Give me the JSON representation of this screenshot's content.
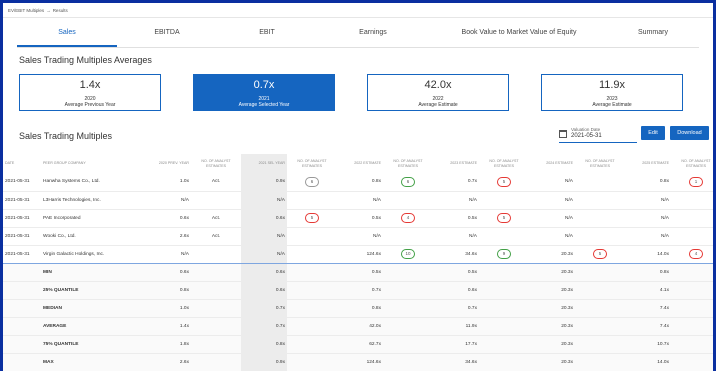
{
  "breadcrumb": [
    "EV/EBIT Multiples",
    "Results"
  ],
  "tabs": [
    {
      "label": "Sales",
      "active": true
    },
    {
      "label": "EBITDA",
      "active": false
    },
    {
      "label": "EBIT",
      "active": false
    },
    {
      "label": "Earnings",
      "active": false
    },
    {
      "label": "Book Value to Market Value of Equity",
      "active": false
    },
    {
      "label": "Summary",
      "active": false
    }
  ],
  "averages": {
    "title": "Sales Trading Multiples Averages",
    "cards": [
      {
        "value": "1.4x",
        "year": "2020",
        "label": "Average Previous Year",
        "selected": false
      },
      {
        "value": "0.7x",
        "year": "2021",
        "label": "Average Selected Year",
        "selected": true
      },
      {
        "value": "42.0x",
        "year": "2022",
        "label": "Average Estimate",
        "selected": false
      },
      {
        "value": "11.9x",
        "year": "2023",
        "label": "Average Estimate",
        "selected": false
      }
    ]
  },
  "multiples": {
    "title": "Sales Trading Multiples",
    "valuation_date_label": "Valuation Date",
    "valuation_date": "2021-05-31",
    "edit_label": "Edit",
    "download_label": "Download",
    "columns": [
      "DATE",
      "PEER GROUP COMPANY",
      "2020 PREV. YEAR",
      "NO. OF ANALYST ESTIMATES",
      "2021 SEL YEAR",
      "NO. OF ANALYST ESTIMATES",
      "2022 ESTIMATE",
      "NO. OF ANALYST ESTIMATES",
      "2023 ESTIMATE",
      "NO. OF ANALYST ESTIMATES",
      "2024 ESTIMATE",
      "NO. OF ANALYST ESTIMATES",
      "2025 ESTIMATE",
      "NO. OF ANALYST ESTIMATES",
      "SPARKLINE"
    ],
    "rows": [
      {
        "date": "2021-05-31",
        "company": "Hanwha Systems Co., Ltd.",
        "y2020": "1.0x",
        "n2020": "Act.",
        "y2021": "0.9x",
        "n2021": "6",
        "y2022": "0.8x",
        "n2022": "6",
        "y2023": "0.7x",
        "n2023": "5",
        "y2024": "N/A",
        "n2024": "",
        "y2025": "0.8x",
        "n2025": "1",
        "spark": true
      },
      {
        "date": "2021-05-31",
        "company": "L3Harris Technologies, Inc.",
        "y2020": "N/A",
        "n2020": "",
        "y2021": "N/A",
        "n2021": "",
        "y2022": "N/A",
        "n2022": "",
        "y2023": "N/A",
        "n2023": "",
        "y2024": "N/A",
        "n2024": "",
        "y2025": "N/A",
        "n2025": "",
        "spark": false
      },
      {
        "date": "2021-05-31",
        "company": "PAE Incorporated",
        "y2020": "0.6x",
        "n2020": "Act.",
        "y2021": "0.6x",
        "n2021": "5",
        "y2022": "0.5x",
        "n2022": "4",
        "y2023": "0.5x",
        "n2023": "5",
        "y2024": "N/A",
        "n2024": "",
        "y2025": "N/A",
        "n2025": "",
        "spark": true
      },
      {
        "date": "2021-05-31",
        "company": "Wooki Co., Ltd.",
        "y2020": "2.6x",
        "n2020": "Act.",
        "y2021": "N/A",
        "n2021": "",
        "y2022": "N/A",
        "n2022": "",
        "y2023": "N/A",
        "n2023": "",
        "y2024": "N/A",
        "n2024": "",
        "y2025": "N/A",
        "n2025": "",
        "spark": false
      },
      {
        "date": "2021-05-31",
        "company": "Virgin Galactic Holdings, Inc.",
        "y2020": "N/A",
        "n2020": "",
        "y2021": "N/A",
        "n2021": "",
        "y2022": "124.6x",
        "n2022": "10",
        "y2023": "34.6x",
        "n2023": "9",
        "y2024": "20.3x",
        "n2024": "5",
        "y2025": "14.0x",
        "n2025": "4",
        "spark": true
      }
    ],
    "summary": [
      {
        "label": "MIN",
        "y2020": "0.6x",
        "y2021": "0.6x",
        "y2022": "0.5x",
        "y2023": "0.5x",
        "y2024": "20.3x",
        "y2025": "0.8x"
      },
      {
        "label": "25% QUANTILE",
        "y2020": "0.8x",
        "y2021": "0.6x",
        "y2022": "0.7x",
        "y2023": "0.6x",
        "y2024": "20.3x",
        "y2025": "4.1x"
      },
      {
        "label": "MEDIAN",
        "y2020": "1.0x",
        "y2021": "0.7x",
        "y2022": "0.8x",
        "y2023": "0.7x",
        "y2024": "20.3x",
        "y2025": "7.4x"
      },
      {
        "label": "AVERAGE",
        "y2020": "1.4x",
        "y2021": "0.7x",
        "y2022": "42.0x",
        "y2023": "11.9x",
        "y2024": "20.3x",
        "y2025": "7.4x"
      },
      {
        "label": "75% QUANTILE",
        "y2020": "1.8x",
        "y2021": "0.8x",
        "y2022": "62.7x",
        "y2023": "17.7x",
        "y2024": "20.3x",
        "y2025": "10.7x"
      },
      {
        "label": "MAX",
        "y2020": "2.6x",
        "y2021": "0.9x",
        "y2022": "124.6x",
        "y2023": "34.6x",
        "y2024": "20.3x",
        "y2025": "14.0x"
      }
    ]
  },
  "colors": {
    "accent": "#1565c0",
    "frame": "#0a2fa0",
    "pill_red": "#e53935",
    "pill_green": "#43a047"
  }
}
